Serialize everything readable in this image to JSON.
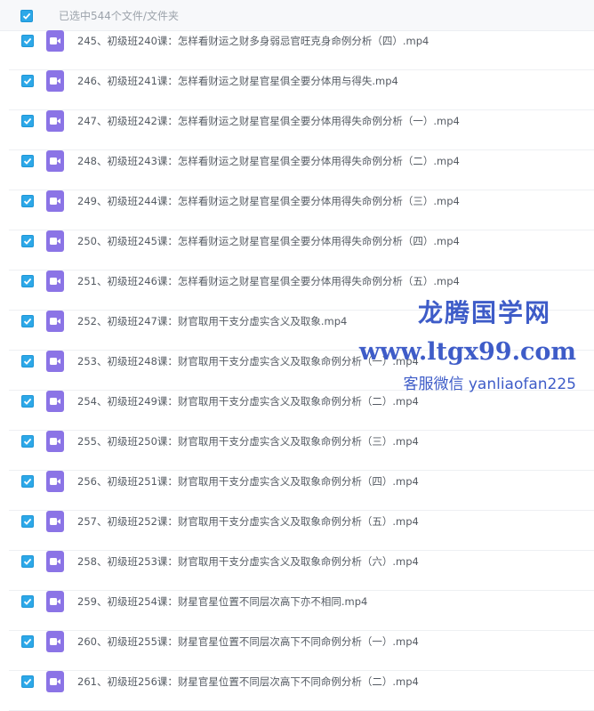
{
  "header": {
    "selected_text": "已选中544个文件/文件夹"
  },
  "files": [
    "245、初级班240课：怎样看财运之财多身弱忌官旺克身命例分析（四）.mp4",
    "246、初级班241课：怎样看财运之财星官星俱全要分体用与得失.mp4",
    "247、初级班242课：怎样看财运之财星官星俱全要分体用得失命例分析（一）.mp4",
    "248、初级班243课：怎样看财运之财星官星俱全要分体用得失命例分析（二）.mp4",
    "249、初级班244课：怎样看财运之财星官星俱全要分体用得失命例分析（三）.mp4",
    "250、初级班245课：怎样看财运之财星官星俱全要分体用得失命例分析（四）.mp4",
    "251、初级班246课：怎样看财运之财星官星俱全要分体用得失命例分析（五）.mp4",
    "252、初级班247课：财官取用干支分虚实含义及取象.mp4",
    "253、初级班248课：财官取用干支分虚实含义及取象命例分析（一）.mp4",
    "254、初级班249课：财官取用干支分虚实含义及取象命例分析（二）.mp4",
    "255、初级班250课：财官取用干支分虚实含义及取象命例分析（三）.mp4",
    "256、初级班251课：财官取用干支分虚实含义及取象命例分析（四）.mp4",
    "257、初级班252课：财官取用干支分虚实含义及取象命例分析（五）.mp4",
    "258、初级班253课：财官取用干支分虚实含义及取象命例分析（六）.mp4",
    "259、初级班254课：财星官星位置不同层次高下亦不相同.mp4",
    "260、初级班255课：财星官星位置不同层次高下不同命例分析（一）.mp4",
    "261、初级班256课：财星官星位置不同层次高下不同命例分析（二）.mp4"
  ],
  "watermark": {
    "line1": "龙腾国学网",
    "line2": "www.ltgx99.com",
    "line3": "客服微信 yanliaofan225"
  },
  "colors": {
    "checkbox": "#2da8e8",
    "video_icon": "#8b74e6",
    "watermark": "#3e5cc8"
  },
  "icons": {
    "row_checkbox": "checked-checkbox-icon",
    "file_type": "video-file-icon"
  }
}
